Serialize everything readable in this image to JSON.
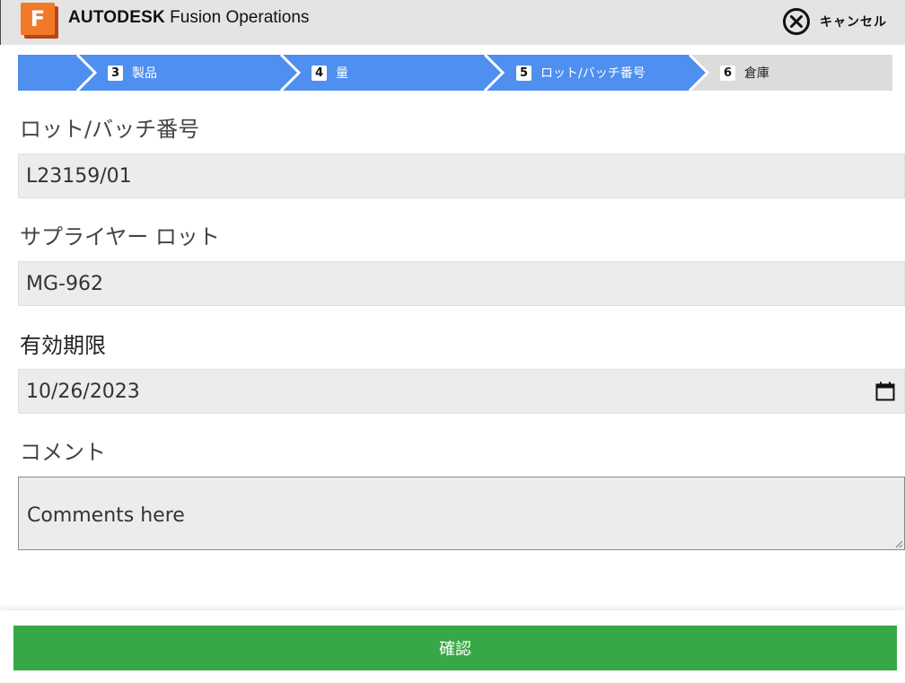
{
  "header": {
    "logo_letter": "F",
    "brand": "AUTODESK",
    "product": "Fusion Operations",
    "cancel_label": "キャンセル"
  },
  "stepper": {
    "steps": [
      {
        "number": "3",
        "label": "製品",
        "state": "done"
      },
      {
        "number": "4",
        "label": "量",
        "state": "done"
      },
      {
        "number": "5",
        "label": "ロット/バッチ番号",
        "state": "active"
      },
      {
        "number": "6",
        "label": "倉庫",
        "state": "upcoming"
      }
    ]
  },
  "form": {
    "lot": {
      "label": "ロット/バッチ番号",
      "value": "L23159/01"
    },
    "supplier_lot": {
      "label": "サプライヤー ロット",
      "value": "MG-962"
    },
    "expiry": {
      "label": "有効期限",
      "value": "10/26/2023"
    },
    "comment": {
      "label": "コメント",
      "placeholder": "Comments here"
    }
  },
  "footer": {
    "confirm_label": "確認"
  },
  "colors": {
    "step_active": "#4f8ff0",
    "step_upcoming": "#dcdcdc",
    "confirm": "#37a846",
    "logo": "#f07a28"
  }
}
